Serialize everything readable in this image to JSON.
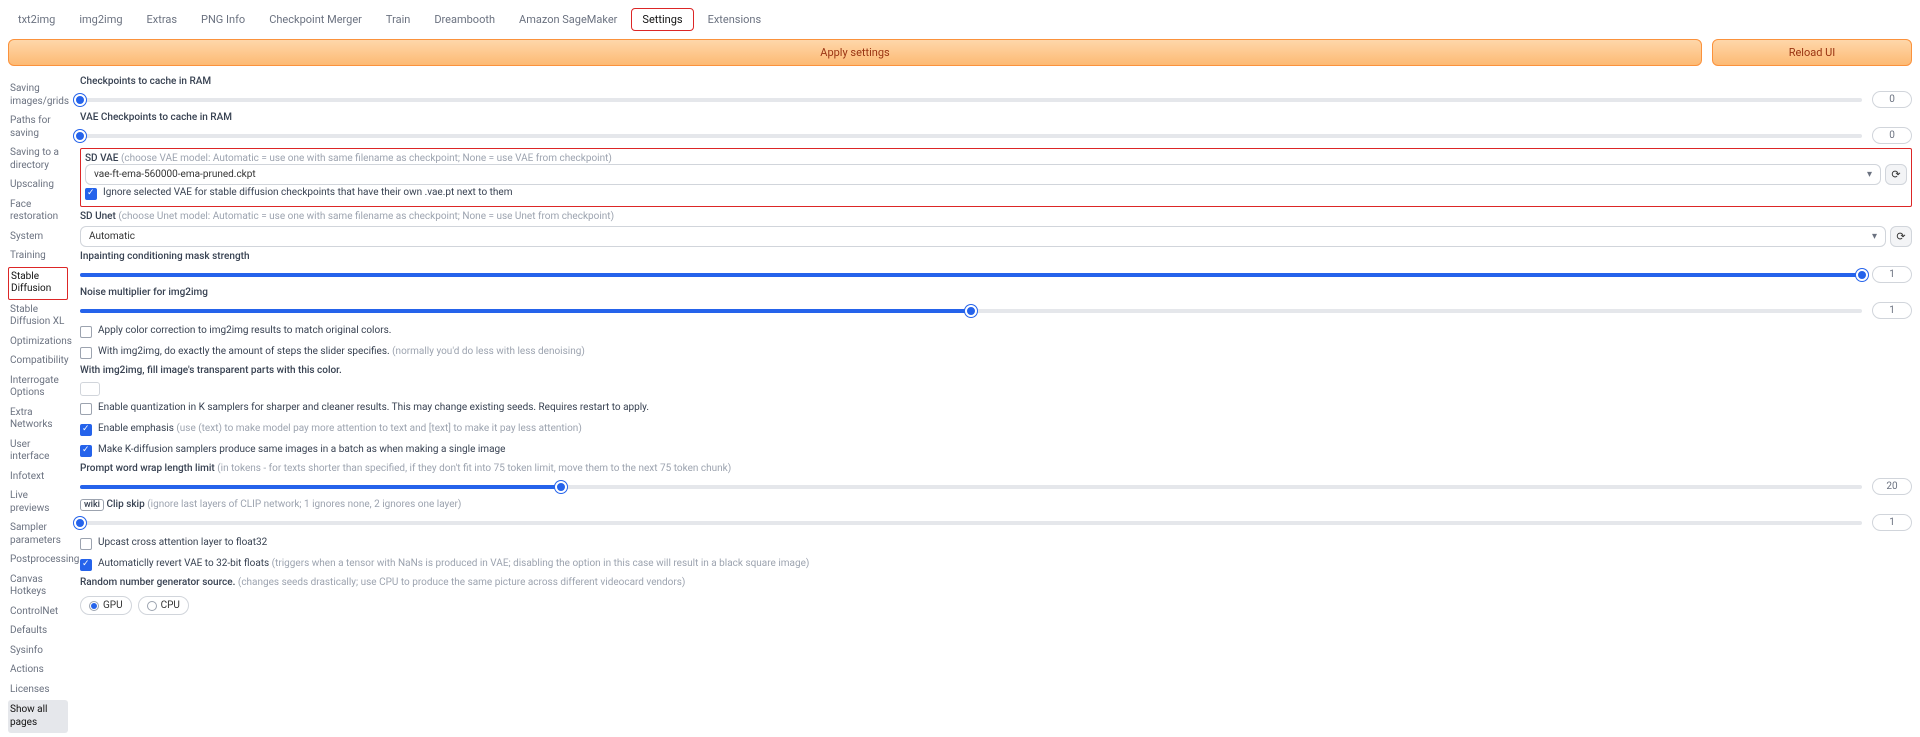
{
  "tabs": {
    "items": [
      "txt2img",
      "img2img",
      "Extras",
      "PNG Info",
      "Checkpoint Merger",
      "Train",
      "Dreambooth",
      "Amazon SageMaker",
      "Settings",
      "Extensions"
    ],
    "active": "Settings"
  },
  "buttons": {
    "apply": "Apply settings",
    "reload": "Reload UI"
  },
  "sidebar": {
    "items": [
      "Saving images/grids",
      "Paths for saving",
      "Saving to a directory",
      "Upscaling",
      "Face restoration",
      "System",
      "Training",
      "Stable Diffusion",
      "Stable Diffusion XL",
      "Optimizations",
      "Compatibility",
      "Interrogate Options",
      "Extra Networks",
      "User interface",
      "Infotext",
      "Live previews",
      "Sampler parameters",
      "Postprocessing",
      "Canvas Hotkeys",
      "ControlNet",
      "Defaults",
      "Sysinfo",
      "Actions",
      "Licenses",
      "Show all pages"
    ],
    "highlighted": "Stable Diffusion",
    "showall": "Show all pages"
  },
  "fields": {
    "ckpt_cache": {
      "label": "Checkpoints to cache in RAM",
      "value": "0",
      "pct": 0
    },
    "vae_cache": {
      "label": "VAE Checkpoints to cache in RAM",
      "value": "0",
      "pct": 0
    },
    "sd_vae": {
      "label": "SD VAE",
      "hint": "(choose VAE model: Automatic = use one with same filename as checkpoint; None = use VAE from checkpoint)",
      "value": "vae-ft-ema-560000-ema-pruned.ckpt"
    },
    "ignore_vae": {
      "label": "Ignore selected VAE for stable diffusion checkpoints that have their own .vae.pt next to them",
      "checked": true
    },
    "sd_unet": {
      "label": "SD Unet",
      "hint": "(choose Unet model: Automatic = use one with same filename as checkpoint; None = use Unet from checkpoint)",
      "value": "Automatic"
    },
    "inpaint_mask": {
      "label": "Inpainting conditioning mask strength",
      "value": "1",
      "pct": 100
    },
    "noise_mult": {
      "label": "Noise multiplier for img2img",
      "value": "1",
      "pct": 50
    },
    "color_correct": {
      "label": "Apply color correction to img2img results to match original colors.",
      "checked": false
    },
    "exact_steps": {
      "label": "With img2img, do exactly the amount of steps the slider specifies.",
      "hint": "(normally you'd do less with less denoising)",
      "checked": false
    },
    "fill_color": {
      "label": "With img2img, fill image's transparent parts with this color."
    },
    "quantization": {
      "label": "Enable quantization in K samplers for sharper and cleaner results. This may change existing seeds. Requires restart to apply.",
      "checked": false
    },
    "emphasis": {
      "label": "Enable emphasis",
      "hint": "(use (text) to make model pay more attention to text and [text] to make it pay less attention)",
      "checked": true
    },
    "kdiff_batch": {
      "label": "Make K-diffusion samplers produce same images in a batch as when making a single image",
      "checked": true
    },
    "prompt_wrap": {
      "label": "Prompt word wrap length limit",
      "hint": "(in tokens - for texts shorter than specified, if they don't fit into 75 token limit, move them to the next 75 token chunk)",
      "value": "20",
      "pct": 27
    },
    "clip_skip": {
      "wiki": "wiki",
      "label": "Clip skip",
      "hint": "(ignore last layers of CLIP network; 1 ignores none, 2 ignores one layer)",
      "value": "1",
      "pct": 0
    },
    "upcast": {
      "label": "Upcast cross attention layer to float32",
      "checked": false
    },
    "auto_revert": {
      "label": "Automaticlly revert VAE to 32-bit floats",
      "hint": "(triggers when a tensor with NaNs is produced in VAE; disabling the option in this case will result in a black square image)",
      "checked": true
    },
    "rng": {
      "label": "Random number generator source.",
      "hint": "(changes seeds drastically; use CPU to produce the same picture across different videocard vendors)",
      "options": [
        "GPU",
        "CPU"
      ],
      "selected": "GPU"
    }
  }
}
